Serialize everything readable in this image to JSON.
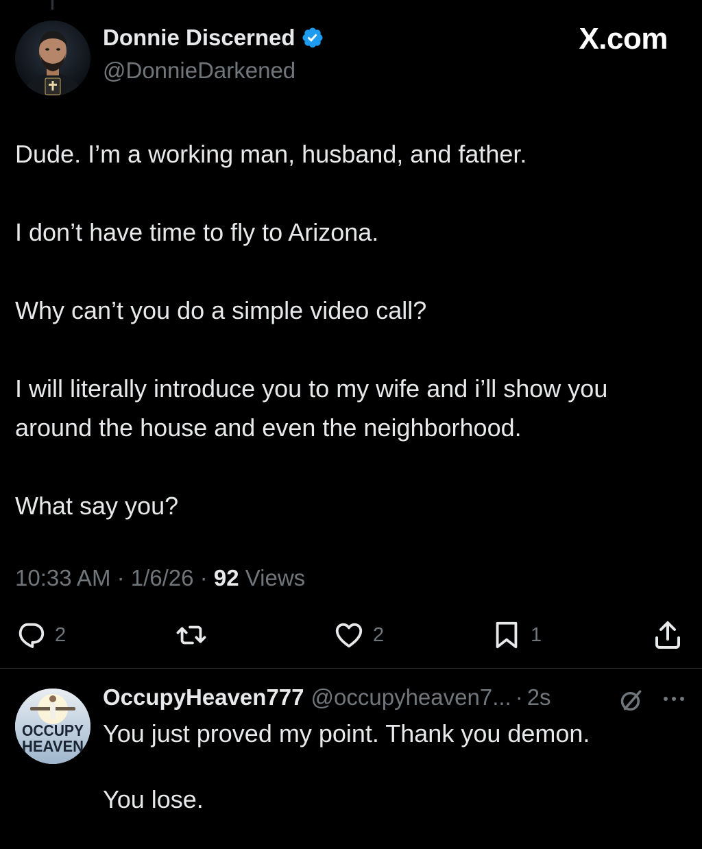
{
  "header": {
    "brand": "X.com"
  },
  "tweet": {
    "author": {
      "display_name": "Donnie Discerned",
      "handle": "@DonnieDarkened",
      "verified": true,
      "avatar_icon": "profile-photo"
    },
    "paragraphs": [
      "Dude. I’m a working man, husband, and father.",
      "I don’t have time to fly to Arizona.",
      "Why can’t you do a simple video call?",
      "I will literally introduce you to my wife and i’ll show you around the house and even the neighborhood.",
      "What say you?"
    ],
    "meta": {
      "time": "10:33 AM",
      "sep1": " · ",
      "date": "1/6/26",
      "sep2": " · ",
      "views_count": "92",
      "views_label": " Views"
    },
    "actions": {
      "replies": "2",
      "reposts": "",
      "likes": "2",
      "bookmarks": "1"
    }
  },
  "reply": {
    "author": {
      "display_name": "OccupyHeaven777",
      "handle": "@occupyheaven7...",
      "dot": "·",
      "time": "2s"
    },
    "avatar_text_line1": "OCCUPY",
    "avatar_text_line2": "HEAVEN",
    "paragraphs": [
      "You just proved my point. Thank you demon.",
      "You lose."
    ]
  },
  "colors": {
    "background": "#000000",
    "text": "#e7e9ea",
    "muted": "#71767b",
    "verified_blue": "#1d9bf0",
    "divider": "#2f3336"
  }
}
